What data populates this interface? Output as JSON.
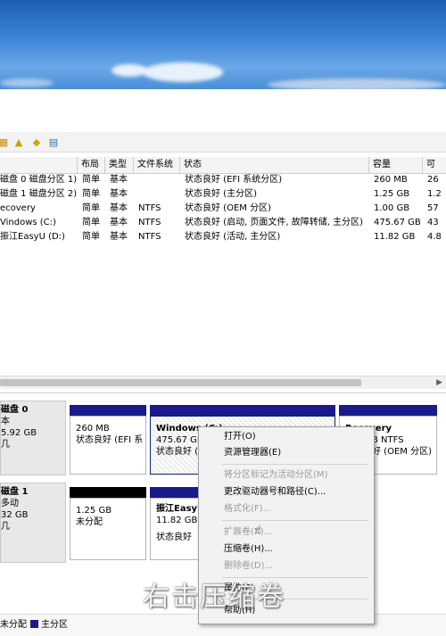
{
  "volume_list": {
    "headers": [
      "布局",
      "类型",
      "文件系统",
      "状态",
      "容量",
      "可"
    ],
    "rows": [
      {
        "name": "磁盘 0 磁盘分区 1)",
        "layout": "简单",
        "type": "基本",
        "fs": "",
        "status": "状态良好 (EFI 系统分区)",
        "capacity": "260 MB",
        "free": "26"
      },
      {
        "name": "磁盘 1 磁盘分区 2)",
        "layout": "简单",
        "type": "基本",
        "fs": "",
        "status": "状态良好 (主分区)",
        "capacity": "1.25 GB",
        "free": "1.2"
      },
      {
        "name": "ecovery",
        "layout": "简单",
        "type": "基本",
        "fs": "NTFS",
        "status": "状态良好 (OEM 分区)",
        "capacity": "1.00 GB",
        "free": "57"
      },
      {
        "name": "Vindows (C:)",
        "layout": "简单",
        "type": "基本",
        "fs": "NTFS",
        "status": "状态良好 (启动, 页面文件, 故障转储, 主分区)",
        "capacity": "475.67 GB",
        "free": "43"
      },
      {
        "name": "振江EasyU (D:)",
        "layout": "简单",
        "type": "基本",
        "fs": "NTFS",
        "status": "状态良好 (活动, 主分区)",
        "capacity": "11.82 GB",
        "free": "4.8"
      }
    ]
  },
  "disks": [
    {
      "label": {
        "name": "磁盘 0",
        "line2": "本",
        "line3": "5.92 GB",
        "line4": "几"
      },
      "partitions": [
        {
          "name": "",
          "size": "260 MB",
          "status": "状态良好 (EFI 系"
        },
        {
          "name": "Windows (C:)",
          "size": "475.67 GE",
          "status": "状态良好 (启"
        },
        {
          "name": "Recovery",
          "size": "B NTFS",
          "status": "状态良好 (OEM 分区)"
        }
      ]
    },
    {
      "label": {
        "name": "磁盘 1",
        "line2": "多动",
        "line3": "32 GB",
        "line4": "几"
      },
      "partitions": [
        {
          "name": "",
          "size": "1.25 GB",
          "status": "未分配"
        },
        {
          "name": "振江EasyU",
          "size": "11.82 GB",
          "status": "状态良好"
        }
      ]
    }
  ],
  "legend": {
    "unallocated": "未分配",
    "primary": "主分区"
  },
  "context_menu": {
    "items": [
      {
        "label": "打开(O)",
        "enabled": true
      },
      {
        "label": "资源管理器(E)",
        "enabled": true
      },
      {
        "label": "将分区标记为活动分区(M)",
        "enabled": false
      },
      {
        "label": "更改驱动器号和路径(C)...",
        "enabled": true
      },
      {
        "label": "格式化(F)...",
        "enabled": false
      },
      {
        "label": "扩展卷(X)...",
        "enabled": false
      },
      {
        "label": "压缩卷(H)...",
        "enabled": true
      },
      {
        "label": "删除卷(D)...",
        "enabled": false
      },
      {
        "label": "属性(P)",
        "enabled": true
      },
      {
        "label": "帮助(H)",
        "enabled": true
      }
    ]
  },
  "caption": "右击压缩卷",
  "colors": {
    "primary_partition": "#1a1a8c",
    "unallocated": "#000000",
    "selection": "#0a246a"
  }
}
